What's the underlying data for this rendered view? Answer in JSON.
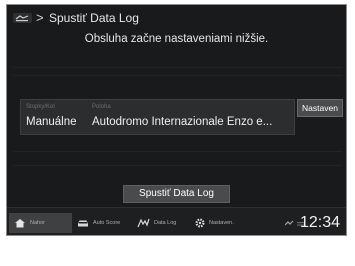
{
  "header": {
    "title": "Spustiť Data Log",
    "separator": ">"
  },
  "hint": "Obsluha začne nastaveniami nižšie.",
  "card": {
    "col1_label": "Stopky/Kol",
    "col1_value": "Manuálne",
    "col2_label": "Poloha",
    "col2_value": "Autodromo Internazionale Enzo e..."
  },
  "settings_button": "Nastaven",
  "start_button": "Spustiť Data Log",
  "nav": [
    {
      "label": "Nahor",
      "icon": "home-icon"
    },
    {
      "label": "Auto Score",
      "icon": "car-icon"
    },
    {
      "label": "Data Log",
      "icon": "data-log-icon"
    },
    {
      "label": "Nastaven.",
      "icon": "gear-icon"
    }
  ],
  "status": {
    "time": "12:34"
  },
  "colors": {
    "background": "#191a1b",
    "button": "#4a4b4d",
    "text": "#e8e8e8"
  }
}
